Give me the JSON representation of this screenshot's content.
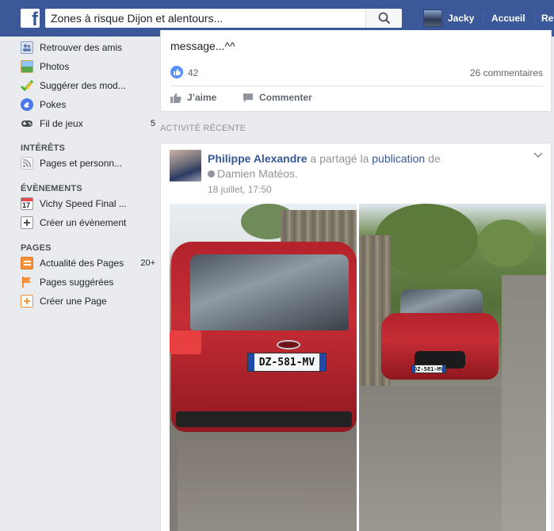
{
  "header": {
    "search_value": "Zones  à risque Dijon et alentours...",
    "user_name": "Jacky",
    "home_label": "Accueil",
    "more_label": "Retr"
  },
  "sidebar": {
    "items_top": [
      {
        "label": "Retrouver des amis",
        "icon": "find-friends-icon"
      },
      {
        "label": "Photos",
        "icon": "photos-icon"
      },
      {
        "label": "Suggérer des mod...",
        "icon": "suggest-edits-icon"
      },
      {
        "label": "Pokes",
        "icon": "pokes-icon"
      },
      {
        "label": "Fil de jeux",
        "icon": "games-icon",
        "count": "5"
      }
    ],
    "interests_title": "INTÉRÊTS",
    "interests": [
      {
        "label": "Pages et personn...",
        "icon": "rss-icon"
      }
    ],
    "events_title": "ÉVÈNEMENTS",
    "events": [
      {
        "label": "Vichy Speed Final ...",
        "icon": "calendar-icon",
        "calendar_day": "17"
      },
      {
        "label": "Créer un évènement",
        "icon": "add-event-icon"
      }
    ],
    "pages_title": "PAGES",
    "pages": [
      {
        "label": "Actualité des Pages",
        "icon": "pages-feed-icon",
        "count": "20+"
      },
      {
        "label": "Pages suggérées",
        "icon": "flag-icon"
      },
      {
        "label": "Créer une Page",
        "icon": "add-page-icon"
      }
    ]
  },
  "post_top": {
    "message_tail": "message...^^",
    "likes": "42",
    "comments": "26 commentaires",
    "like_action": "J’aime",
    "comment_action": "Commenter"
  },
  "recent_activity_title": "ACTIVITÉ RÉCENTE",
  "post2": {
    "author": "Philippe Alexandre",
    "verb": "a partagé la",
    "link": "publication",
    "of": "de",
    "shared_from": "Damien Matéos.",
    "date": "18 juillet, 17:50",
    "plate_left": "DZ-581-MV",
    "plate_right": "DZ-581-MV"
  },
  "colors": {
    "brand_blue": "#3b5998",
    "link_blue": "#365899",
    "background": "#e9ebee",
    "like_blue": "#5890ff"
  }
}
